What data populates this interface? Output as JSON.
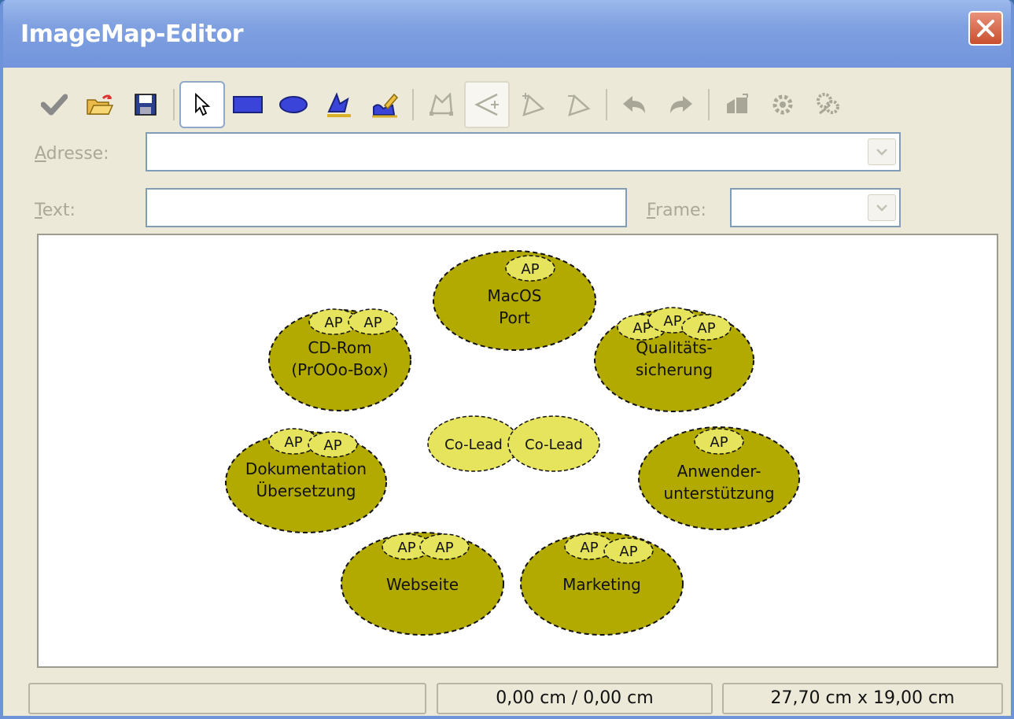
{
  "window": {
    "title": "ImageMap-Editor"
  },
  "toolbar": {
    "buttons": [
      {
        "name": "apply-icon"
      },
      {
        "name": "open-icon"
      },
      {
        "name": "save-icon"
      },
      {
        "name": "select-icon"
      },
      {
        "name": "rectangle-icon"
      },
      {
        "name": "ellipse-icon"
      },
      {
        "name": "polygon-icon"
      },
      {
        "name": "freeform-polygon-icon"
      },
      {
        "name": "edit-points-icon"
      },
      {
        "name": "move-points-icon"
      },
      {
        "name": "insert-points-icon"
      },
      {
        "name": "delete-points-icon"
      },
      {
        "name": "undo-icon"
      },
      {
        "name": "redo-icon"
      },
      {
        "name": "active-icon"
      },
      {
        "name": "macro-icon"
      },
      {
        "name": "properties-icon"
      }
    ]
  },
  "form": {
    "address_label_first": "A",
    "address_label_rest": "dresse:",
    "address_value": "",
    "text_label_first": "T",
    "text_label_rest": "ext:",
    "text_value": "",
    "frame_label_first": "F",
    "frame_label_rest": "rame:",
    "frame_value": ""
  },
  "canvas": {
    "colors": {
      "big": "#b3aa00",
      "small": "#e6e35c",
      "center": "#e6e35c"
    },
    "labels": {
      "macos": [
        "MacOS",
        "Port"
      ],
      "cdrom": [
        "CD-Rom",
        "(PrOOo-Box)"
      ],
      "qual": [
        "Qualitäts-",
        "sicherung"
      ],
      "doku": [
        "Dokumentation",
        "Übersetzung"
      ],
      "anwender": [
        "Anwender-",
        "unterstützung"
      ],
      "web": [
        "Webseite"
      ],
      "marketing": [
        "Marketing"
      ],
      "colead": "Co-Lead",
      "ap": "AP"
    }
  },
  "status": {
    "left": "",
    "position": "0,00 cm / 0,00 cm",
    "size": "27,70 cm x 19,00 cm"
  }
}
